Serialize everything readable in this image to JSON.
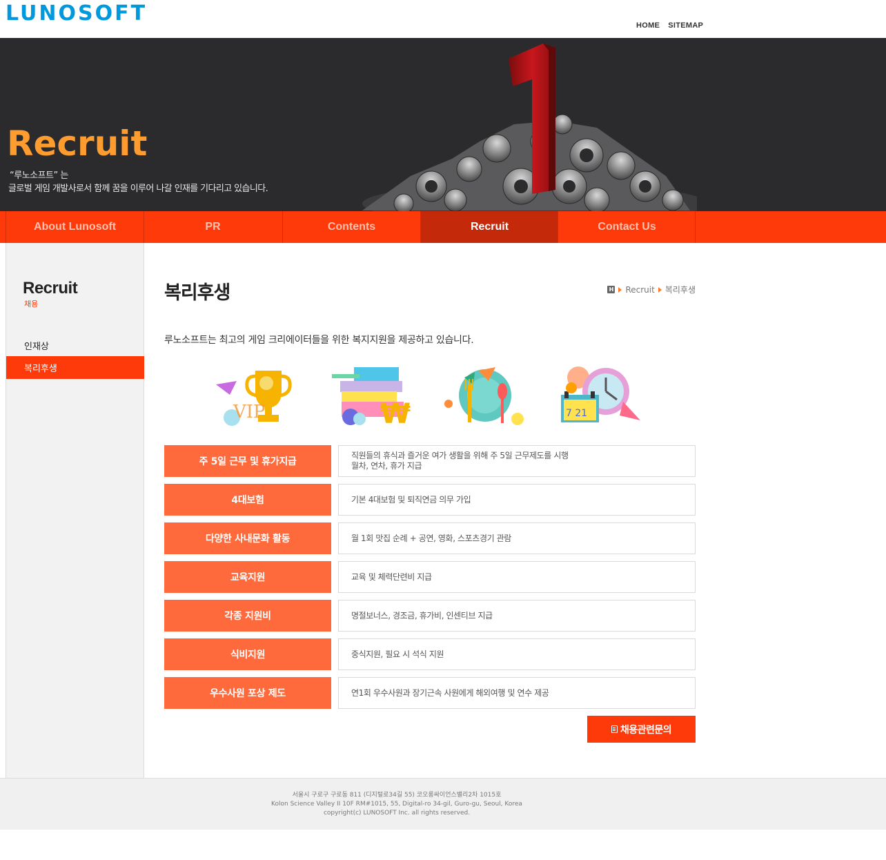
{
  "header": {
    "logo": "LUNOSOFT",
    "nav": [
      "HOME",
      "SITEMAP"
    ]
  },
  "banner": {
    "title": "Recruit",
    "subtitle_line1": "“루노소프트” 는",
    "subtitle_line2": "글로벌 게임 개발사로서 함께 꿈을 이루어 나갈 인재를 기다리고 있습니다."
  },
  "mainnav": {
    "items": [
      "About Lunosoft",
      "PR",
      "Contents",
      "Recruit",
      "Contact Us"
    ],
    "active": "Recruit"
  },
  "sidebar": {
    "title": "Recruit",
    "subtitle": "채용",
    "items": [
      "인재상",
      "복리후생"
    ],
    "active": "복리후생"
  },
  "content": {
    "page_title": "복리후생",
    "breadcrumb": [
      "Recruit",
      "복리후생"
    ],
    "home_icon_letter": "H",
    "intro": "루노소프트는 최고의 게임 크리에이터들을 위한 복지지원을 제공하고 있습니다.",
    "icons": [
      "trophy-vip-icon",
      "card-won-icon",
      "dining-plate-icon",
      "calendar-clock-icon"
    ],
    "icon_texts": {
      "vip": "VIP",
      "won": "₩",
      "cal": "7 21"
    },
    "benefits": [
      {
        "label": "주 5일 근무 및 휴가지급",
        "desc1": "직원들의 휴식과 즐거운 여가 생활을 위해 주 5일 근무제도를 시행",
        "desc2": "월차, 연차, 휴가 지급"
      },
      {
        "label": "4대보험",
        "desc1": "기본 4대보험 및 퇴직연금 의무 가입",
        "desc2": ""
      },
      {
        "label": "다양한 사내문화 활동",
        "desc1": "월 1회 맛집 순례 + 공연, 영화, 스포츠경기 관람",
        "desc2": ""
      },
      {
        "label": "교육지원",
        "desc1": "교육 및 체력단련비 지급",
        "desc2": ""
      },
      {
        "label": "각종 지원비",
        "desc1": "명절보너스, 경조금, 휴가비, 인센티브 지급",
        "desc2": ""
      },
      {
        "label": "식비지원",
        "desc1": "중식지원, 필요 시 석식 지원",
        "desc2": ""
      },
      {
        "label": "우수사원 포상 제도",
        "desc1": "연1회 우수사원과 장기근속 사원에게 해외여행 및 연수 제공",
        "desc2": ""
      }
    ],
    "contact_button": "채용관련문의"
  },
  "footer": {
    "line1": "서울시 구로구 구로동 811 (디지털로34길 55) 코오롱싸이언스밸리2차 1015호",
    "line2": "Kolon Science Valley II 10F RM#1015, 55, Digital-ro 34-gil, Guro-gu, Seoul, Korea",
    "line3": "copyright(c) LUNOSOFT Inc. all rights reserved."
  },
  "colors": {
    "accent": "#ff3a0a",
    "accent_dark": "#c4290a",
    "label_bg": "#ff6a3d",
    "banner_bg": "#2b2b2e",
    "banner_title": "#ff9c2f",
    "logo": "#0099dd"
  }
}
